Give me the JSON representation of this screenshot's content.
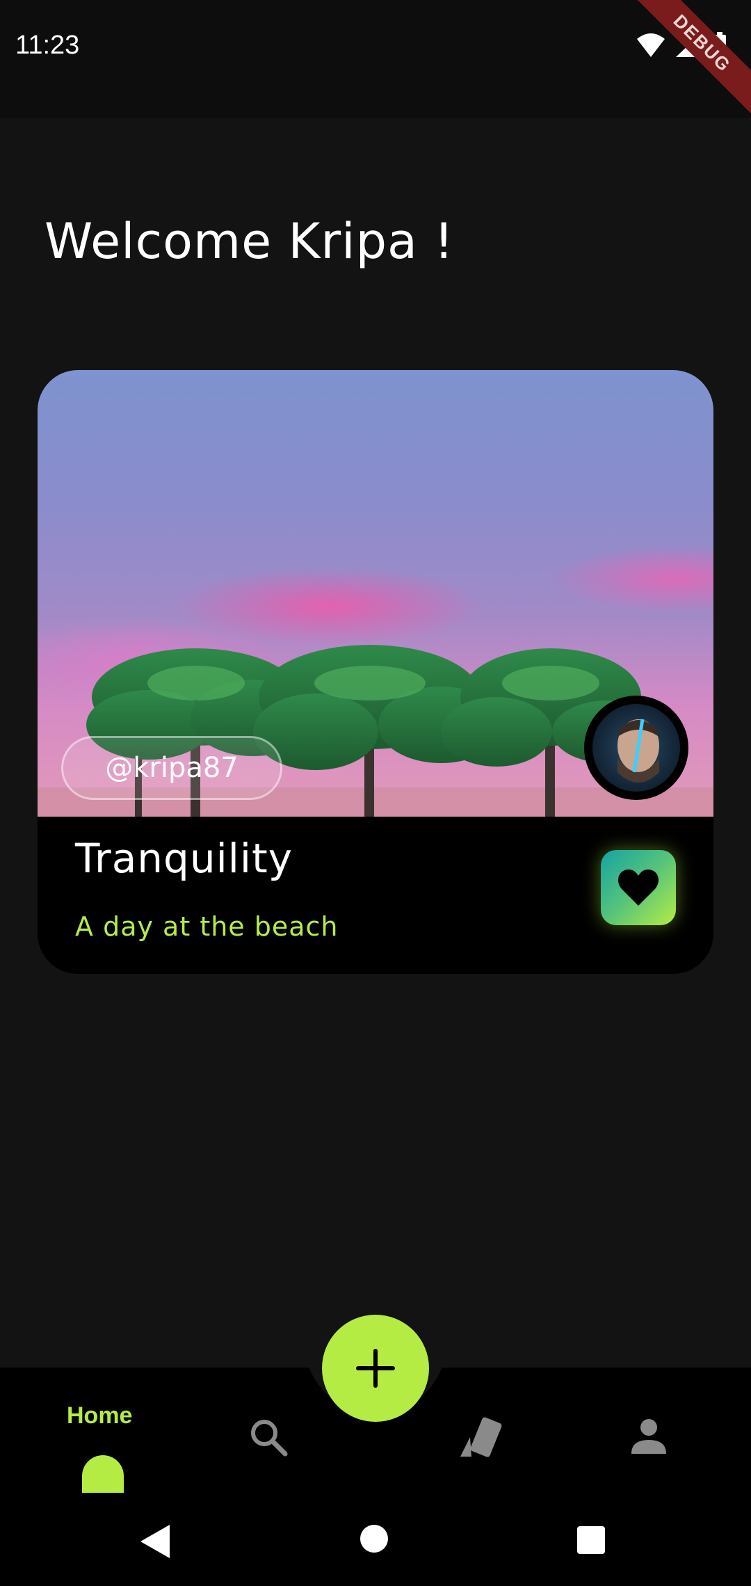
{
  "status_bar": {
    "time": "11:23",
    "icons": [
      "wifi-icon",
      "signal-icon",
      "battery-icon"
    ],
    "debug_banner": "DEBUG"
  },
  "header": {
    "welcome_text": "Welcome Kripa !"
  },
  "post_card": {
    "username": "@kripa87",
    "title": "Tranquility",
    "subtitle": "A day at the beach",
    "like_icon": "heart-icon",
    "colors": {
      "subtitle": "#b5ec4a",
      "like_gradient_start": "#14a3a4",
      "like_gradient_end": "#b5ec44"
    }
  },
  "bottom_nav": {
    "home_label": "Home",
    "fab_icon": "plus-icon",
    "items": [
      {
        "name": "home",
        "icon": "home-icon",
        "active": true
      },
      {
        "name": "search",
        "icon": "search-icon",
        "active": false
      },
      {
        "name": "cards",
        "icon": "cards-icon",
        "active": false
      },
      {
        "name": "profile",
        "icon": "person-icon",
        "active": false
      }
    ],
    "accent_color": "#b5ec44"
  },
  "system_nav": {
    "buttons": [
      "back-icon",
      "home-circle-icon",
      "recents-icon"
    ]
  }
}
